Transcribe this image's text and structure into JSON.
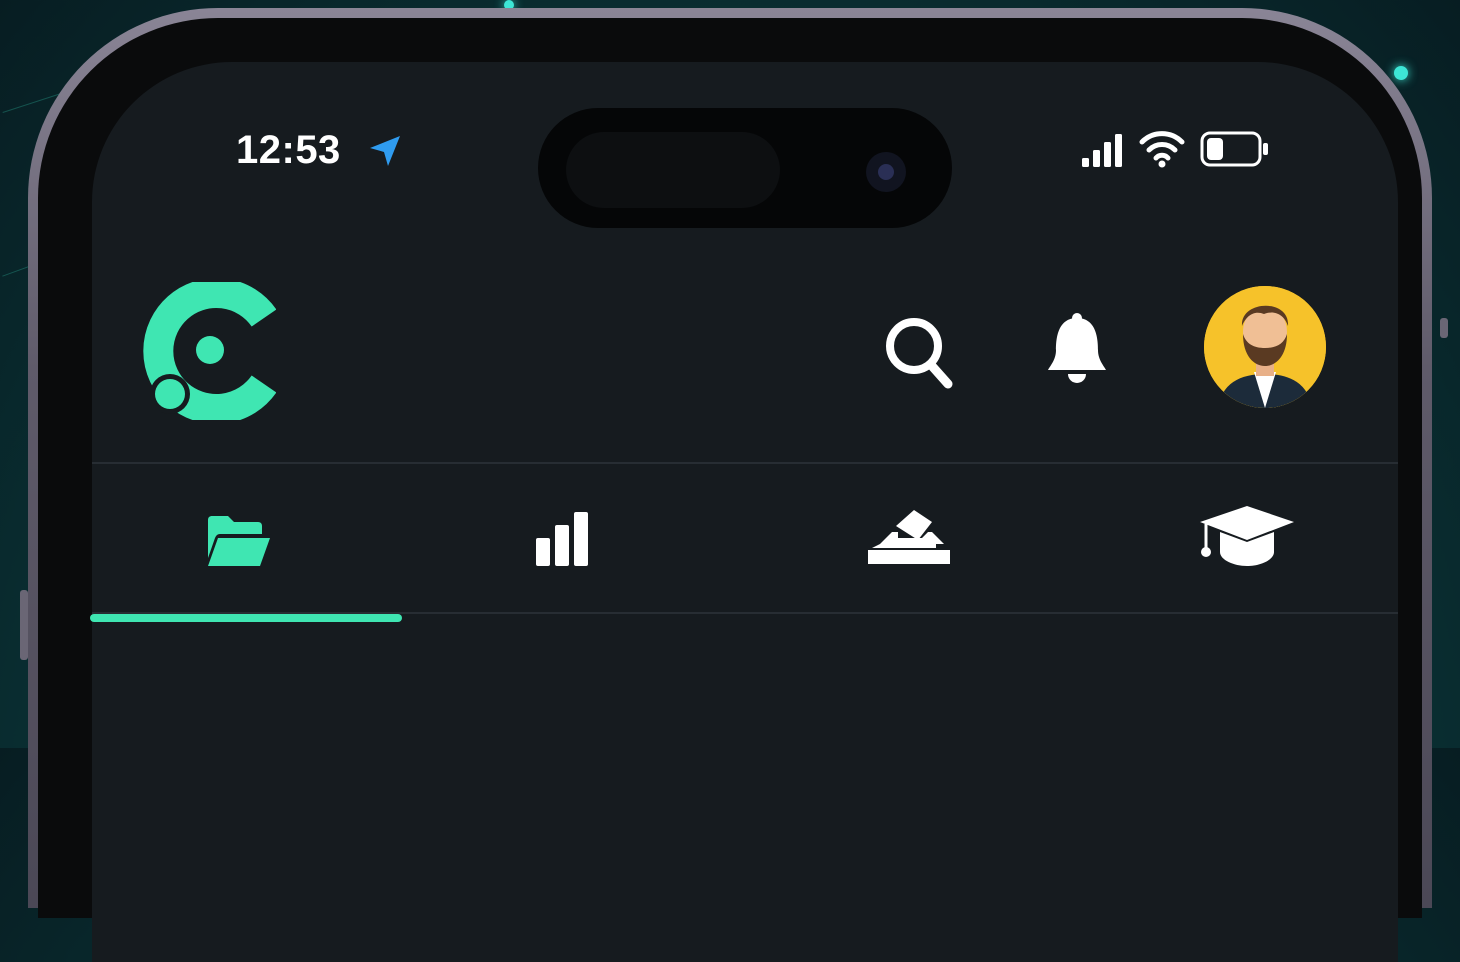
{
  "status_bar": {
    "time": "12:53",
    "icons": [
      "location-arrow-icon",
      "signal-bars-icon",
      "wifi-icon",
      "battery-icon"
    ]
  },
  "header": {
    "logo": "app-logo-icon",
    "actions": [
      "search-icon",
      "bell-icon",
      "user-avatar"
    ]
  },
  "tabs": [
    {
      "icon": "folder-open-icon",
      "active": true
    },
    {
      "icon": "bar-chart-icon",
      "active": false
    },
    {
      "icon": "ballot-box-icon",
      "active": false
    },
    {
      "icon": "graduation-cap-icon",
      "active": false
    }
  ],
  "colors": {
    "accent": "#3fe6b2",
    "screen_background": "#161b1f",
    "icon_white": "#ffffff",
    "location_blue": "#2f9cf0",
    "avatar_background": "#f6c22a"
  }
}
